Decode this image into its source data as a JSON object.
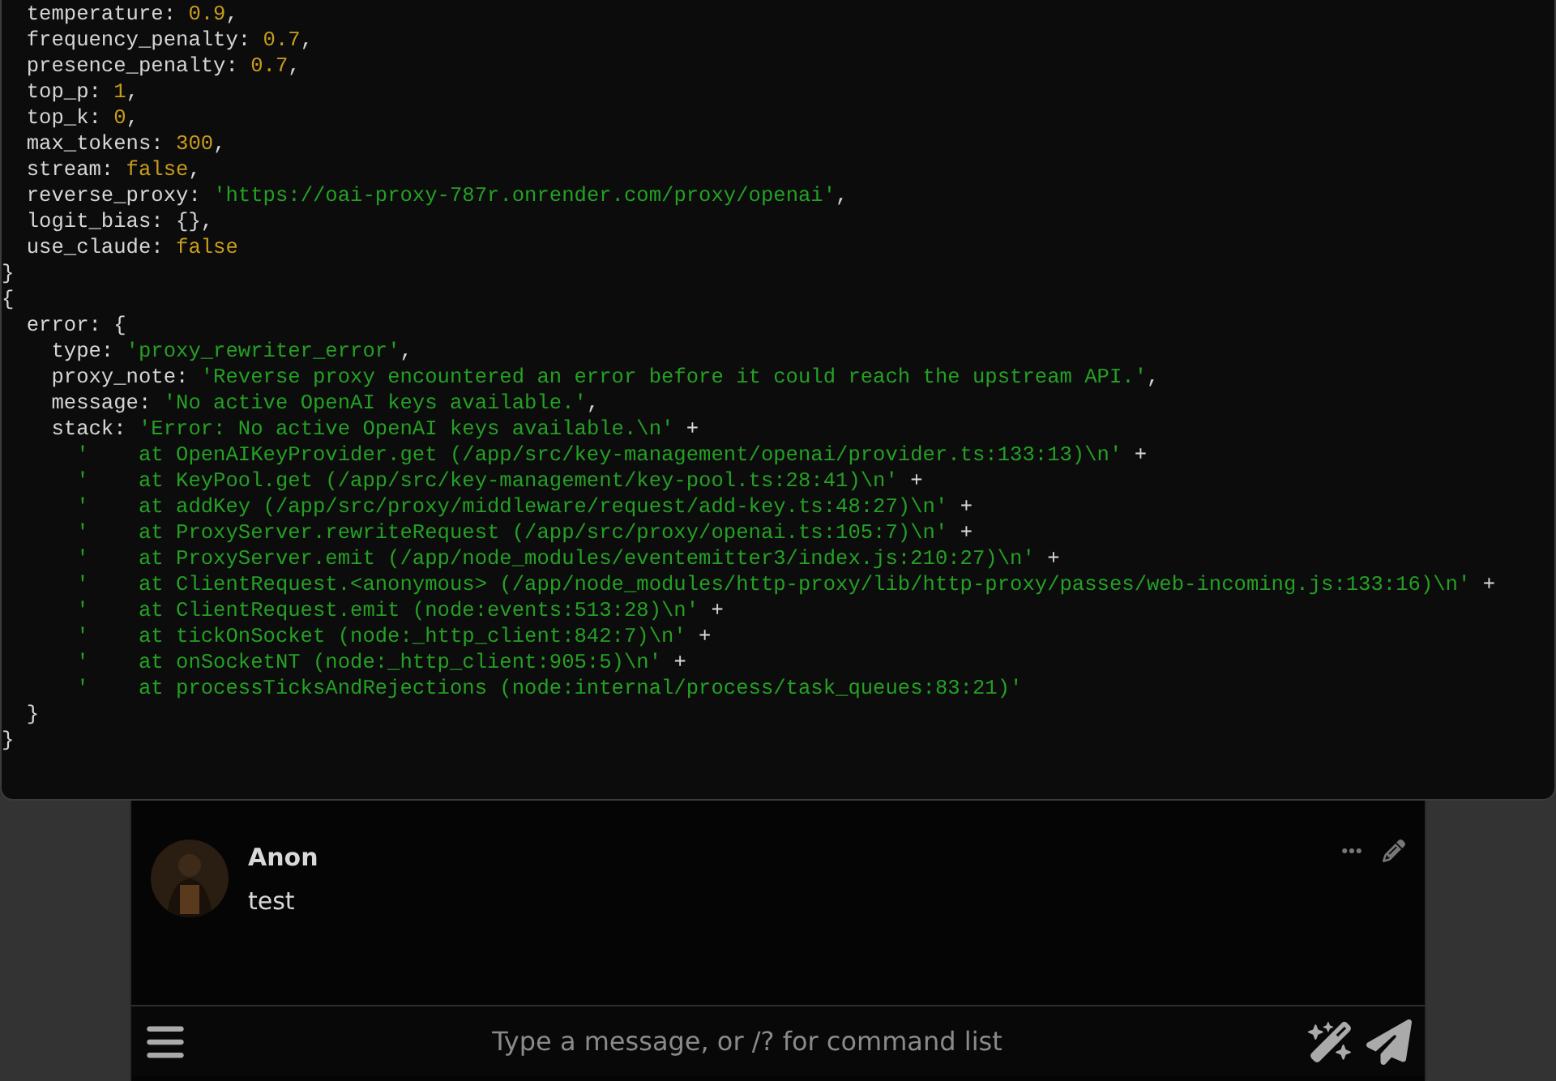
{
  "code_lines": [
    [
      {
        "kind": "plain",
        "text": "  temperature: "
      },
      {
        "kind": "number",
        "text": "0.9"
      },
      {
        "kind": "plain",
        "text": ","
      }
    ],
    [
      {
        "kind": "plain",
        "text": "  frequency_penalty: "
      },
      {
        "kind": "number",
        "text": "0.7"
      },
      {
        "kind": "plain",
        "text": ","
      }
    ],
    [
      {
        "kind": "plain",
        "text": "  presence_penalty: "
      },
      {
        "kind": "number",
        "text": "0.7"
      },
      {
        "kind": "plain",
        "text": ","
      }
    ],
    [
      {
        "kind": "plain",
        "text": "  top_p: "
      },
      {
        "kind": "number",
        "text": "1"
      },
      {
        "kind": "plain",
        "text": ","
      }
    ],
    [
      {
        "kind": "plain",
        "text": "  top_k: "
      },
      {
        "kind": "number",
        "text": "0"
      },
      {
        "kind": "plain",
        "text": ","
      }
    ],
    [
      {
        "kind": "plain",
        "text": "  max_tokens: "
      },
      {
        "kind": "number",
        "text": "300"
      },
      {
        "kind": "plain",
        "text": ","
      }
    ],
    [
      {
        "kind": "plain",
        "text": "  stream: "
      },
      {
        "kind": "number",
        "text": "false"
      },
      {
        "kind": "plain",
        "text": ","
      }
    ],
    [
      {
        "kind": "plain",
        "text": "  reverse_proxy: "
      },
      {
        "kind": "string",
        "text": "'https://oai-proxy-787r.onrender.com/proxy/openai'"
      },
      {
        "kind": "plain",
        "text": ","
      }
    ],
    [
      {
        "kind": "plain",
        "text": "  logit_bias: {},"
      }
    ],
    [
      {
        "kind": "plain",
        "text": "  use_claude: "
      },
      {
        "kind": "number",
        "text": "false"
      }
    ],
    [
      {
        "kind": "plain",
        "text": "}"
      }
    ],
    [
      {
        "kind": "plain",
        "text": "{"
      }
    ],
    [
      {
        "kind": "plain",
        "text": "  error: {"
      }
    ],
    [
      {
        "kind": "plain",
        "text": "    type: "
      },
      {
        "kind": "string",
        "text": "'proxy_rewriter_error'"
      },
      {
        "kind": "plain",
        "text": ","
      }
    ],
    [
      {
        "kind": "plain",
        "text": "    proxy_note: "
      },
      {
        "kind": "string",
        "text": "'Reverse proxy encountered an error before it could reach the upstream API.'"
      },
      {
        "kind": "plain",
        "text": ","
      }
    ],
    [
      {
        "kind": "plain",
        "text": "    message: "
      },
      {
        "kind": "string",
        "text": "'No active OpenAI keys available.'"
      },
      {
        "kind": "plain",
        "text": ","
      }
    ],
    [
      {
        "kind": "plain",
        "text": "    stack: "
      },
      {
        "kind": "string",
        "text": "'Error: No active OpenAI keys available.\\n'"
      },
      {
        "kind": "plain",
        "text": " +"
      }
    ],
    [
      {
        "kind": "string",
        "text": "      '    at OpenAIKeyProvider.get (/app/src/key-management/openai/provider.ts:133:13)\\n'"
      },
      {
        "kind": "plain",
        "text": " +"
      }
    ],
    [
      {
        "kind": "string",
        "text": "      '    at KeyPool.get (/app/src/key-management/key-pool.ts:28:41)\\n'"
      },
      {
        "kind": "plain",
        "text": " +"
      }
    ],
    [
      {
        "kind": "string",
        "text": "      '    at addKey (/app/src/proxy/middleware/request/add-key.ts:48:27)\\n'"
      },
      {
        "kind": "plain",
        "text": " +"
      }
    ],
    [
      {
        "kind": "string",
        "text": "      '    at ProxyServer.rewriteRequest (/app/src/proxy/openai.ts:105:7)\\n'"
      },
      {
        "kind": "plain",
        "text": " +"
      }
    ],
    [
      {
        "kind": "string",
        "text": "      '    at ProxyServer.emit (/app/node_modules/eventemitter3/index.js:210:27)\\n'"
      },
      {
        "kind": "plain",
        "text": " +"
      }
    ],
    [
      {
        "kind": "string",
        "text": "      '    at ClientRequest.<anonymous> (/app/node_modules/http-proxy/lib/http-proxy/passes/web-incoming.js:133:16)\\n'"
      },
      {
        "kind": "plain",
        "text": " +"
      }
    ],
    [
      {
        "kind": "string",
        "text": "      '    at ClientRequest.emit (node:events:513:28)\\n'"
      },
      {
        "kind": "plain",
        "text": " +"
      }
    ],
    [
      {
        "kind": "string",
        "text": "      '    at tickOnSocket (node:_http_client:842:7)\\n'"
      },
      {
        "kind": "plain",
        "text": " +"
      }
    ],
    [
      {
        "kind": "string",
        "text": "      '    at onSocketNT (node:_http_client:905:5)\\n'"
      },
      {
        "kind": "plain",
        "text": " +"
      }
    ],
    [
      {
        "kind": "string",
        "text": "      '    at processTicksAndRejections (node:internal/process/task_queues:83:21)'"
      }
    ],
    [
      {
        "kind": "plain",
        "text": "  }"
      }
    ],
    [
      {
        "kind": "plain",
        "text": "}"
      }
    ]
  ],
  "message": {
    "author": "Anon",
    "text": "test"
  },
  "composer": {
    "placeholder": "Type a message, or /? for command list"
  }
}
